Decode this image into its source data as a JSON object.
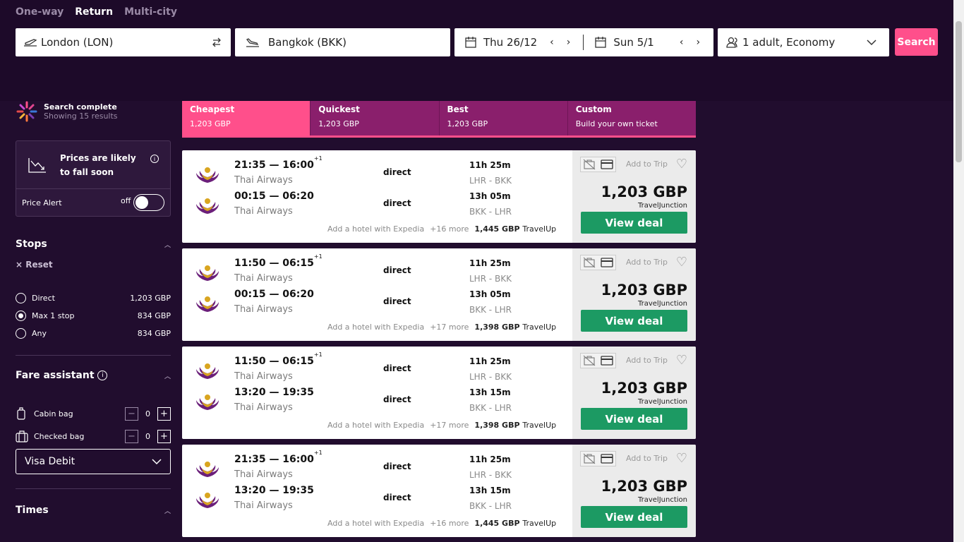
{
  "header": {
    "trip_types": [
      "One-way",
      "Return",
      "Multi-city"
    ],
    "active_trip_type": "Return",
    "origin": "London (LON)",
    "destination": "Bangkok (BKK)",
    "depart_date": "Thu 26/12",
    "return_date": "Sun 5/1",
    "travellers": "1 adult, Economy",
    "search_label": "Search"
  },
  "sidebar": {
    "status_title": "Search complete",
    "status_sub": "Showing 15 results",
    "alert_text": "Prices are likely to fall soon",
    "price_alert_label": "Price Alert",
    "toggle_label": "off",
    "stops_title": "Stops",
    "reset_label": "Reset",
    "stops": [
      {
        "label": "Direct",
        "price": "1,203 GBP",
        "selected": false
      },
      {
        "label": "Max 1 stop",
        "price": "834 GBP",
        "selected": true
      },
      {
        "label": "Any",
        "price": "834 GBP",
        "selected": false
      }
    ],
    "fare_title": "Fare assistant",
    "bags": [
      {
        "label": "Cabin bag",
        "count": "0"
      },
      {
        "label": "Checked bag",
        "count": "0"
      }
    ],
    "payment": "Visa Debit",
    "times_title": "Times"
  },
  "sort_tabs": [
    {
      "name": "Cheapest",
      "sub": "1,203 GBP"
    },
    {
      "name": "Quickest",
      "sub": "1,203 GBP"
    },
    {
      "name": "Best",
      "sub": "1,203 GBP"
    },
    {
      "name": "Custom",
      "sub": "Build your own ticket"
    }
  ],
  "results": [
    {
      "legs": [
        {
          "times": "21:35 — 16:00",
          "plus": "+1",
          "airline": "Thai Airways",
          "stops": "direct",
          "duration": "11h 25m",
          "route": "LHR - BKK"
        },
        {
          "times": "00:15 — 06:20",
          "plus": "",
          "airline": "Thai Airways",
          "stops": "direct",
          "duration": "13h 05m",
          "route": "BKK - LHR"
        }
      ],
      "hotel": "Add a hotel with Expedia",
      "more": "+16 more",
      "alt_price": "1,445 GBP",
      "alt_provider": "TravelUp",
      "add_trip": "Add to Trip",
      "price": "1,203 GBP",
      "provider": "TravelJunction",
      "cta": "View deal"
    },
    {
      "legs": [
        {
          "times": "11:50 — 06:15",
          "plus": "+1",
          "airline": "Thai Airways",
          "stops": "direct",
          "duration": "11h 25m",
          "route": "LHR - BKK"
        },
        {
          "times": "00:15 — 06:20",
          "plus": "",
          "airline": "Thai Airways",
          "stops": "direct",
          "duration": "13h 05m",
          "route": "BKK - LHR"
        }
      ],
      "hotel": "Add a hotel with Expedia",
      "more": "+17 more",
      "alt_price": "1,398 GBP",
      "alt_provider": "TravelUp",
      "add_trip": "Add to Trip",
      "price": "1,203 GBP",
      "provider": "TravelJunction",
      "cta": "View deal"
    },
    {
      "legs": [
        {
          "times": "11:50 — 06:15",
          "plus": "+1",
          "airline": "Thai Airways",
          "stops": "direct",
          "duration": "11h 25m",
          "route": "LHR - BKK"
        },
        {
          "times": "13:20 — 19:35",
          "plus": "",
          "airline": "Thai Airways",
          "stops": "direct",
          "duration": "13h 15m",
          "route": "BKK - LHR"
        }
      ],
      "hotel": "Add a hotel with Expedia",
      "more": "+17 more",
      "alt_price": "1,398 GBP",
      "alt_provider": "TravelUp",
      "add_trip": "Add to Trip",
      "price": "1,203 GBP",
      "provider": "TravelJunction",
      "cta": "View deal"
    },
    {
      "legs": [
        {
          "times": "21:35 — 16:00",
          "plus": "+1",
          "airline": "Thai Airways",
          "stops": "direct",
          "duration": "11h 25m",
          "route": "LHR - BKK"
        },
        {
          "times": "13:20 — 19:35",
          "plus": "",
          "airline": "Thai Airways",
          "stops": "direct",
          "duration": "13h 15m",
          "route": "BKK - LHR"
        }
      ],
      "hotel": "Add a hotel with Expedia",
      "more": "+16 more",
      "alt_price": "1,445 GBP",
      "alt_provider": "TravelUp",
      "add_trip": "Add to Trip",
      "price": "1,203 GBP",
      "provider": "TravelJunction",
      "cta": "View deal"
    }
  ],
  "colors": {
    "accent": "#ff4f8b",
    "cta": "#1c9a63",
    "tab": "#8a1f6c",
    "bg": "#210d2e"
  }
}
